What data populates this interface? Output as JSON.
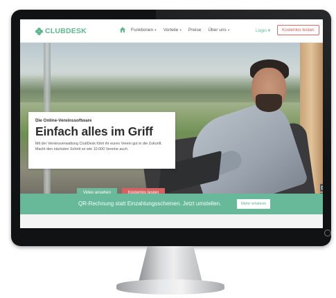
{
  "brand": {
    "logo_text": "CLUBDESK",
    "accent": "#5fb78d",
    "cta_color": "#d46262"
  },
  "nav": {
    "home_icon": "home-icon",
    "links": [
      {
        "label": "Funktionen",
        "has_caret": true
      },
      {
        "label": "Vorteile",
        "has_caret": true
      },
      {
        "label": "Preise",
        "has_caret": false
      },
      {
        "label": "Über uns",
        "has_caret": true
      }
    ],
    "caret": "▾",
    "login": "Login ▾",
    "cta": "Kostenlos testen"
  },
  "hero": {
    "eyebrow": "Die Online-Vereinssoftware",
    "title": "Einfach alles im Griff",
    "description": "Mit der Vereinsverwaltung ClubDesk führt ihr euren Verein gut in die Zukunft. Macht den nächsten Schritt so wie 10.000 Vereine auch.",
    "video_button": "Video ansehen",
    "trial_button": "Kostenlos testen"
  },
  "side_tools": [
    "chat-icon",
    "search-icon",
    "accessibility-icon"
  ],
  "banner": {
    "text": "QR-Rechnung statt Einzahlungsscheinen. Jetzt umstellen.",
    "button": "Mehr erfahren"
  }
}
